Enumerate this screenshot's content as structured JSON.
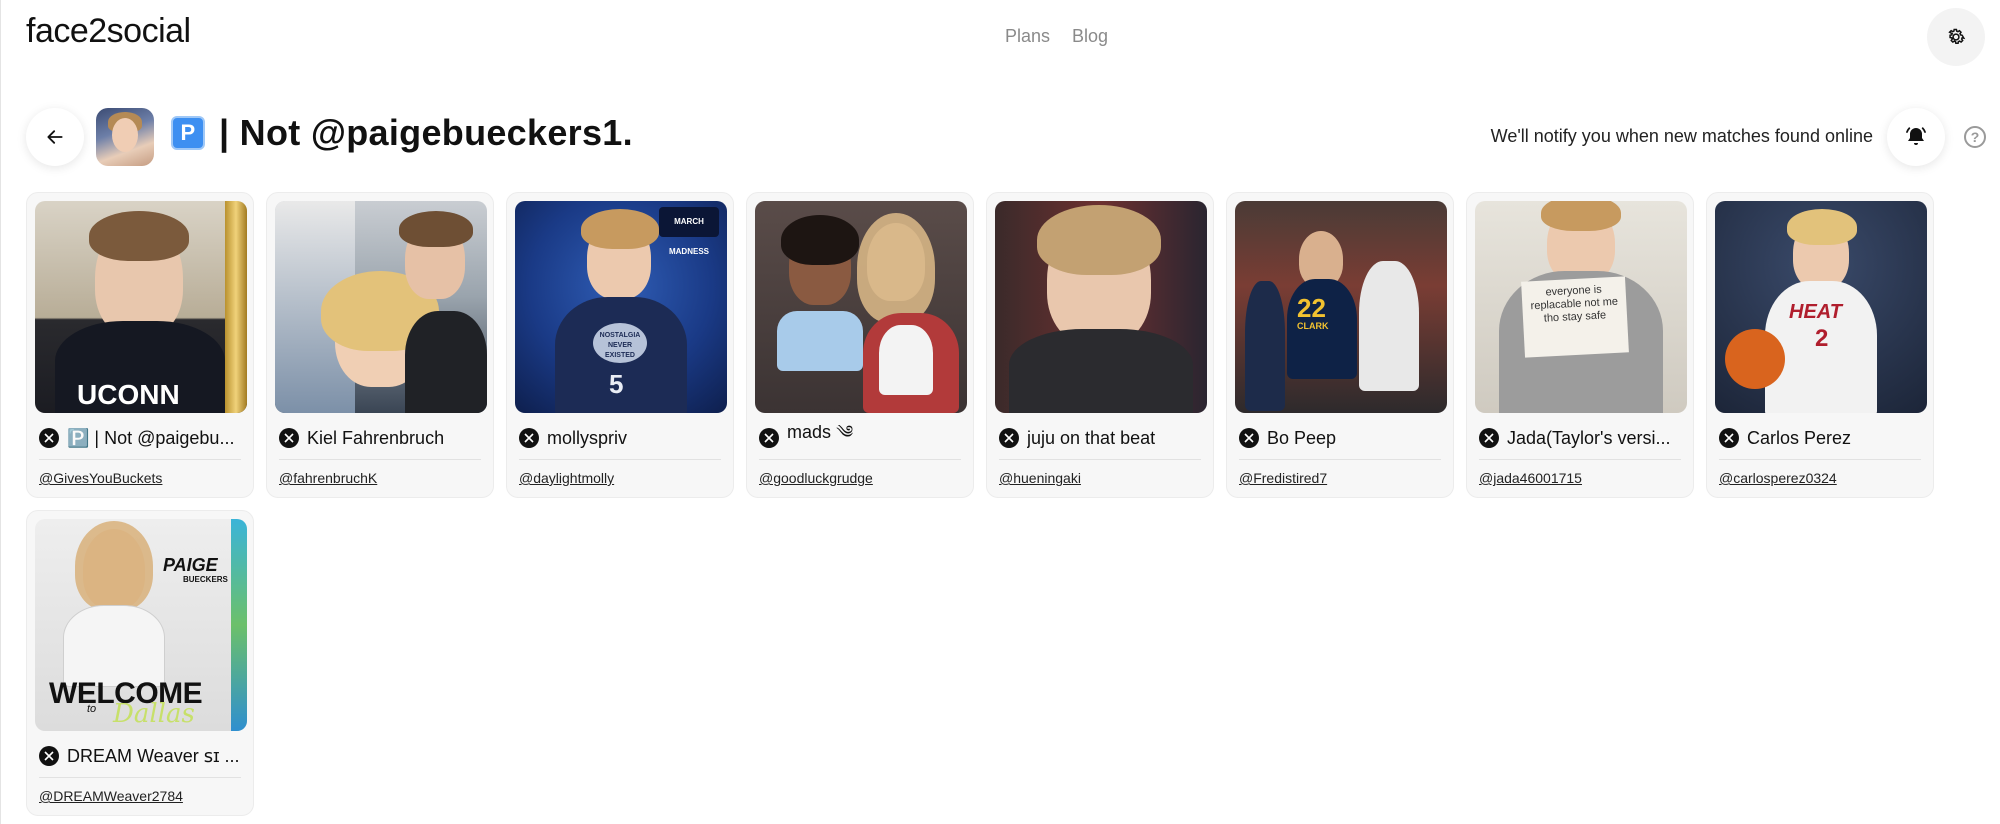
{
  "brand": "face2social",
  "nav": {
    "plans": "Plans",
    "blog": "Blog"
  },
  "profile": {
    "badge": "P",
    "title": "| Not @paigebueckers1."
  },
  "notify_text": "We'll notify you when new matches found online",
  "help_label": "?",
  "icons": {
    "settings": "gear-icon",
    "back": "arrow-left-icon",
    "bell": "bell-icon",
    "help": "question-circle-icon",
    "platform": "x-logo-icon"
  },
  "matches": [
    {
      "name": "🅿️ | Not @paigebu...",
      "handle": "@GivesYouBuckets",
      "has_badge": true
    },
    {
      "name": "Kiel Fahrenbruch",
      "handle": "@fahrenbruchK"
    },
    {
      "name": "mollyspriv",
      "handle": "@daylightmolly"
    },
    {
      "name": "mads ༄ؘ",
      "handle": "@goodluckgrudge"
    },
    {
      "name": "juju on that beat",
      "handle": "@hueningaki"
    },
    {
      "name": "Bo Peep",
      "handle": "@Fredistired7"
    },
    {
      "name": "Jada(Taylor's versi...",
      "handle": "@jada46001715"
    },
    {
      "name": "Carlos Perez",
      "handle": "@carlosperez0324"
    },
    {
      "name": "DREAM Weaver ꜱɪ ...",
      "handle": "@DREAMWeaver2784"
    }
  ],
  "thumb_text": {
    "card0_jersey": "UCONN",
    "card2_badge": "MARCH MADNESS",
    "card2_sign": "NOSTALGIA NEVER EXISTED",
    "card2_number": "5",
    "card5_number": "22",
    "card5_name": "CLARK",
    "card6_sign": "everyone is replacable not me tho stay safe",
    "card7_team": "HEAT",
    "card7_number": "2",
    "card8_name": "PAIGE",
    "card8_sub": "BUECKERS",
    "card8_welcome": "WELCOME",
    "card8_to": "to",
    "card8_city": "Dallas"
  }
}
